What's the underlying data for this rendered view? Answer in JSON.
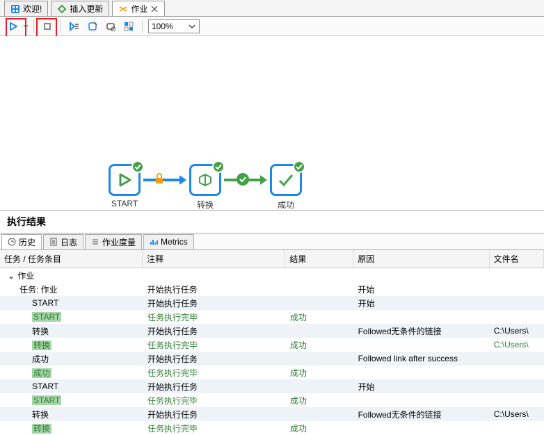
{
  "tabs": [
    {
      "label": "欢迎!",
      "active": false
    },
    {
      "label": "插入更新",
      "active": false
    },
    {
      "label": "作业",
      "active": true
    }
  ],
  "zoom": "100%",
  "nodes": {
    "start": "START",
    "transform": "转换",
    "success": "成功"
  },
  "annotations": {
    "run": "运行",
    "stop": "停止"
  },
  "results": {
    "title": "执行结果",
    "tabs": [
      "历史",
      "日志",
      "作业度量",
      "Metrics"
    ],
    "columns": [
      "任务 / 任务条目",
      "注释",
      "结果",
      "原因",
      "文件名"
    ],
    "rootLabel": "作业",
    "rows": [
      {
        "task": "任务: 作业",
        "comment": "开始执行任务",
        "result": "",
        "reason": "开始",
        "file": "",
        "style": "norm"
      },
      {
        "task": "START",
        "comment": "开始执行任务",
        "result": "",
        "reason": "开始",
        "file": "",
        "style": "norm",
        "indent": true
      },
      {
        "task": "START",
        "comment": "任务执行完毕",
        "result": "成功",
        "reason": "",
        "file": "",
        "style": "green",
        "indent": true
      },
      {
        "task": "转换",
        "comment": "开始执行任务",
        "result": "",
        "reason": "Followed无条件的链接",
        "file": "C:\\Users\\",
        "style": "norm",
        "indent": true
      },
      {
        "task": "转换",
        "comment": "任务执行完毕",
        "result": "成功",
        "reason": "",
        "file": "C:\\Users\\",
        "style": "green",
        "indent": true
      },
      {
        "task": "成功",
        "comment": "开始执行任务",
        "result": "",
        "reason": "Followed link after success",
        "file": "",
        "style": "norm",
        "indent": true
      },
      {
        "task": "成功",
        "comment": "任务执行完毕",
        "result": "成功",
        "reason": "",
        "file": "",
        "style": "green",
        "indent": true
      },
      {
        "task": "START",
        "comment": "开始执行任务",
        "result": "",
        "reason": "开始",
        "file": "",
        "style": "norm",
        "indent": true
      },
      {
        "task": "START",
        "comment": "任务执行完毕",
        "result": "成功",
        "reason": "",
        "file": "",
        "style": "green",
        "indent": true
      },
      {
        "task": "转换",
        "comment": "开始执行任务",
        "result": "",
        "reason": "Followed无条件的链接",
        "file": "C:\\Users\\",
        "style": "norm",
        "indent": true
      },
      {
        "task": "转换",
        "comment": "任务执行完毕",
        "result": "成功",
        "reason": "",
        "file": "",
        "style": "green",
        "indent": true
      }
    ]
  }
}
